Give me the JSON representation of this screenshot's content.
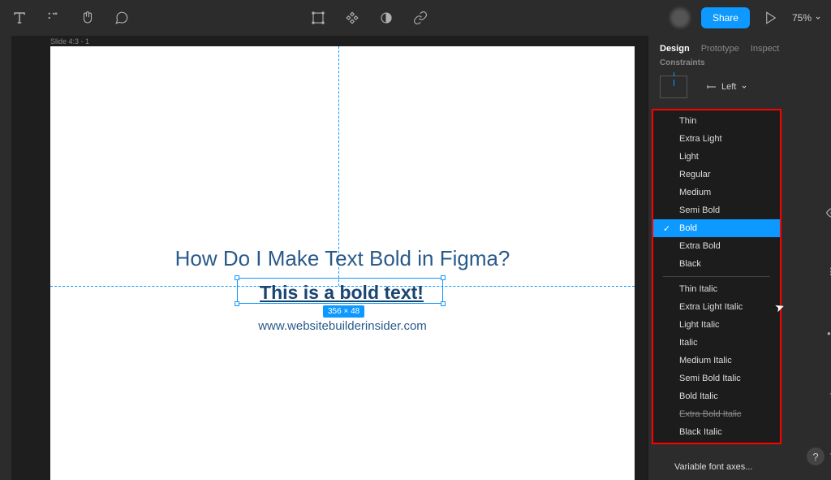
{
  "toolbar": {
    "share_label": "Share",
    "zoom_level": "75%"
  },
  "canvas": {
    "slide_label": "Slide 4:3 - 1",
    "title_text": "How Do I Make Text Bold in Figma?",
    "bold_text": "This is a bold text!",
    "url_text": "www.websitebuilderinsider.com",
    "dimensions": "356 × 48"
  },
  "panel": {
    "tabs": {
      "design": "Design",
      "prototype": "Prototype",
      "inspect": "Inspect"
    },
    "constraints_label": "Constraints",
    "constraint_value": "Left",
    "variable_axes": "Variable font axes..."
  },
  "fontWeights": {
    "items": [
      {
        "label": "Thin",
        "selected": false
      },
      {
        "label": "Extra Light",
        "selected": false
      },
      {
        "label": "Light",
        "selected": false
      },
      {
        "label": "Regular",
        "selected": false
      },
      {
        "label": "Medium",
        "selected": false
      },
      {
        "label": "Semi Bold",
        "selected": false
      },
      {
        "label": "Bold",
        "selected": true
      },
      {
        "label": "Extra Bold",
        "selected": false
      },
      {
        "label": "Black",
        "selected": false
      }
    ],
    "italics": [
      {
        "label": "Thin Italic"
      },
      {
        "label": "Extra Light Italic"
      },
      {
        "label": "Light Italic"
      },
      {
        "label": "Italic"
      },
      {
        "label": "Medium Italic"
      },
      {
        "label": "Semi Bold Italic"
      },
      {
        "label": "Bold Italic"
      },
      {
        "label": "Extra Bold Italic",
        "strike": true
      },
      {
        "label": "Black Italic"
      }
    ]
  }
}
